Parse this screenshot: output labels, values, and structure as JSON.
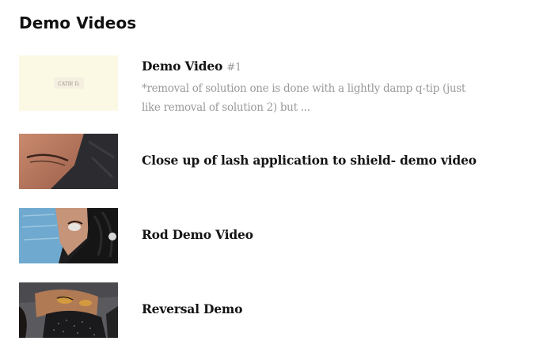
{
  "section": {
    "heading": "Demo Videos"
  },
  "videos": [
    {
      "title": "Demo Video",
      "number": "#1",
      "description": "*removal of solution one is done with a lightly damp q-tip (just like removal of solution 2) but ...",
      "thumbnail_text": "CATIE D.",
      "thumbnail_icon": "logo-thumbnail"
    },
    {
      "title": "Close up of lash application to shield- demo video",
      "thumbnail_icon": "closed-eye-closeup-thumbnail"
    },
    {
      "title": "Rod Demo Video",
      "thumbnail_icon": "masked-client-thumbnail"
    },
    {
      "title": "Reversal Demo",
      "thumbnail_icon": "reclining-client-thumbnail"
    }
  ],
  "colors": {
    "title_text": "#141414",
    "description_text": "#9a9a9a",
    "thumbnail_cream": "#fbf9e4"
  }
}
